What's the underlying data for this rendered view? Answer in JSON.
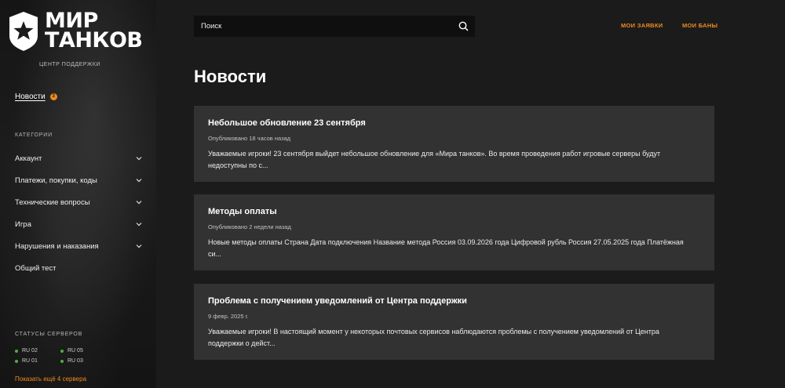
{
  "logo": {
    "line1": "МИР",
    "line2": "ТАНКОВ"
  },
  "sidebar": {
    "support_center": "ЦЕНТР ПОДДЕРЖКИ",
    "news": {
      "label": "Новости",
      "badge": "3"
    },
    "categories_title": "КАТЕГОРИИ",
    "categories": [
      {
        "label": "Аккаунт",
        "expandable": true
      },
      {
        "label": "Платежи, покупки, коды",
        "expandable": true
      },
      {
        "label": "Технические вопросы",
        "expandable": true
      },
      {
        "label": "Игра",
        "expandable": true
      },
      {
        "label": "Нарушения и наказания",
        "expandable": true
      },
      {
        "label": "Общий тест",
        "expandable": false
      }
    ],
    "servers_title": "СТАТУСЫ СЕРВЕРОВ",
    "servers": [
      {
        "name": "RU 02",
        "status": "online"
      },
      {
        "name": "RU 05",
        "status": "online"
      },
      {
        "name": "RU 01",
        "status": "online"
      },
      {
        "name": "RU 03",
        "status": "online"
      }
    ],
    "show_more": "Показать ещё 4 сервера"
  },
  "header": {
    "search_placeholder": "Поиск",
    "my_requests": "МОИ ЗАЯВКИ",
    "my_bans": "МОИ БАНЫ"
  },
  "main": {
    "title": "Новости",
    "news": [
      {
        "title": "Небольшое обновление 23 сентября",
        "date": "Опубликовано 18 часов назад",
        "text": "Уважаемые игроки! 23 сентября выйдет небольшое обновление для «Мира танков». Во время проведения работ игровые серверы будут недоступны по с..."
      },
      {
        "title": "Методы оплаты",
        "date": "Опубликовано 2 недели назад",
        "text": "Новые методы оплаты Страна Дата подключения Название метода Россия 03.09.2026 года Цифровой рубль Россия 27.05.2025 года Платёжная си..."
      },
      {
        "title": "Проблема с получением уведомлений от Центра поддержки",
        "date": "9 февр. 2025 г.",
        "text": "Уважаемые игроки! В настоящий момент у некоторых почтовых сервисов наблюдаются проблемы с получением уведомлений от Центра поддержки о дейст..."
      }
    ]
  },
  "colors": {
    "accent": "#f08a1c",
    "background": "#1b1b1c",
    "card": "#323233",
    "status_online": "#4caf3d"
  },
  "icons": {
    "logo": "star-shield-icon",
    "search": "search-icon",
    "chevron": "chevron-down-icon"
  }
}
